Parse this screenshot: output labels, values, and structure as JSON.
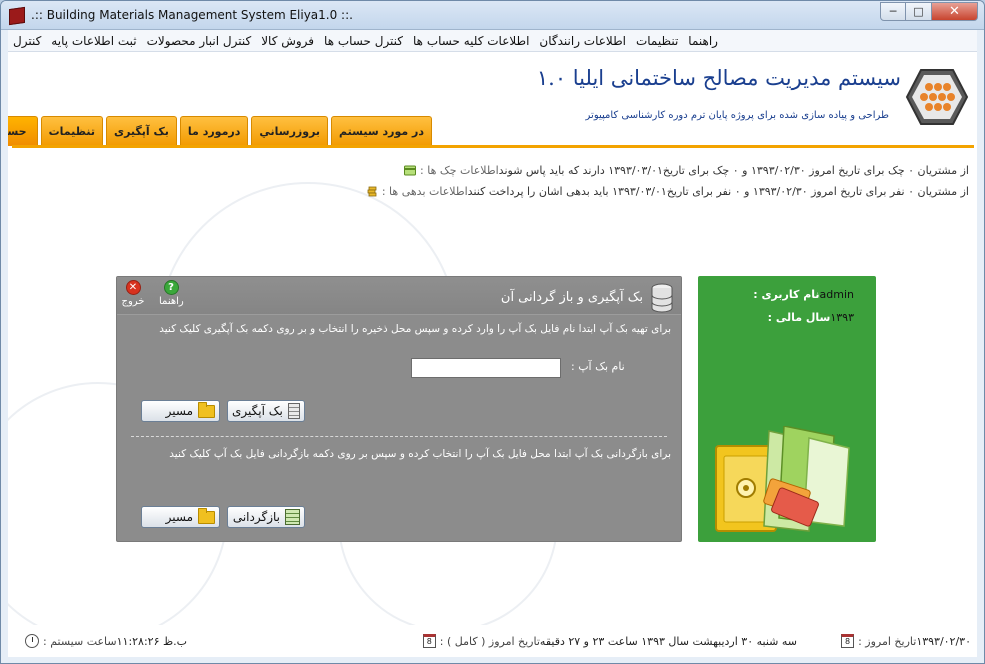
{
  "window": {
    "title": ".:: Building Materials Management System Eliya1.0 ::."
  },
  "menu": [
    "کنترل",
    "ثبت اطلاعات پایه",
    "کنترل انبار محصولات",
    "فروش کالا",
    "کنترل حساب ها",
    "اطلاعات کلیه حساب ها",
    "اطلاعات رانندگان",
    "تنظیمات",
    "راهنما"
  ],
  "header": {
    "title": "سیستم مدیریت مصالح ساختمانی ایلیا ۱.۰",
    "subtitle": "طراحی و پیاده سازی شده برای پروژه پایان ترم دوره کارشناسی کامپیوتر"
  },
  "tabs": [
    "حساب کاربری",
    "تنظیمات",
    "بک آپگیری",
    "درمورد ما",
    "بروزرساني",
    "در مورد سیستم"
  ],
  "info": {
    "checks_label": "اطلاعات چک ها :",
    "checks_text": "از مشتریان ۰ چک برای تاریخ امروز ۱۳۹۳/۰۲/۳۰ و ۰ چک برای تاریخ۱۳۹۳/۰۳/۰۱ دارند که باید پاس شوند",
    "debts_label": "اطلاعات بدهی ها :",
    "debts_text": "از مشتریان ۰ نفر برای تاریخ امروز ۱۳۹۳/۰۲/۳۰ و ۰ نفر برای تاریخ۱۳۹۳/۰۳/۰۱ باید بدهی اشان را پرداخت کنند"
  },
  "user_panel": {
    "username_label": "نام کاربری :",
    "username": "admin",
    "fiscal_year_label": "سال مالی :",
    "fiscal_year": "۱۳۹۳",
    "accent": "#3ca03c"
  },
  "backup_panel": {
    "title": "بک آپگیری و باز گردانی آن",
    "help_label": "راهنما",
    "exit_label": "خروج",
    "backup_instructions": "برای تهیه بک آپ ابتدا نام فایل بک آپ را وارد کرده و سپس محل ذخیره را انتخاب و بر روی دکمه بک آپگیری کلیک کنید",
    "filename_label": "نام بک آپ :",
    "filename_value": "",
    "path_button": "مسیر",
    "backup_button": "بک آپگیری",
    "restore_instructions": "برای بازگردانی بک آپ ابتدا محل فایل بک آپ را انتخاب کرده و سپس  بر روی دکمه بازگردانی فایل بک آپ کلیک کنید",
    "restore_path_button": "مسیر",
    "restore_button": "بازگردانی"
  },
  "status": {
    "date_label": "تاریخ امروز :",
    "date": "۱۳۹۳/۰۲/۳۰",
    "full_date_label": "تاریخ امروز ( کامل ) :",
    "full_date": "سه شنبه ۳۰ اردیبهشت سال ۱۳۹۳ ساعت ۲۳ و ۲۷ دقیقه",
    "time_label": "ساعت سیستم :",
    "time": "ب.ظ ۱۱:۲۸:۲۶"
  },
  "colors": {
    "tab_orange": "#f29a00",
    "header_blue": "#1a3f8f",
    "panel_gray": "#8c8c8c"
  }
}
